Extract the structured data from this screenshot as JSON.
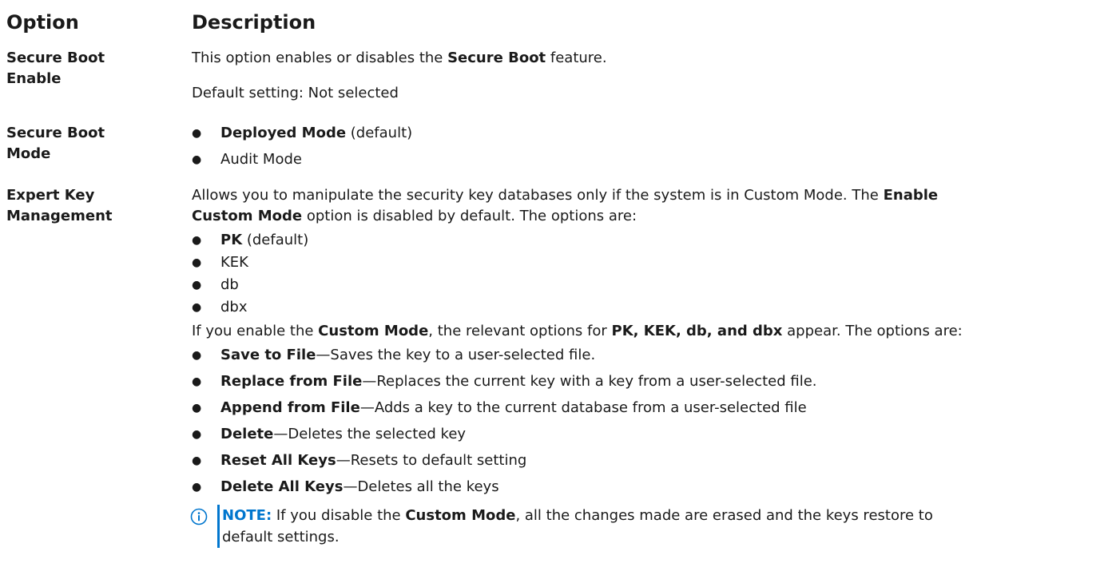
{
  "header": {
    "option": "Option",
    "description": "Description"
  },
  "rows": [
    {
      "option_line1": "Secure Boot",
      "option_line2": "Enable",
      "desc_pre": "This option enables or disables the ",
      "desc_bold": "Secure Boot",
      "desc_post": " feature.",
      "default": "Default setting: Not selected"
    },
    {
      "option_line1": "Secure Boot",
      "option_line2": "Mode",
      "items": [
        {
          "bold": "Deployed Mode",
          "rest": " (default)"
        },
        {
          "bold": "",
          "rest": "Audit Mode"
        }
      ]
    },
    {
      "option_line1": "Expert Key",
      "option_line2": "Management",
      "intro_pre": "Allows you to manipulate the security key databases only if the system is in Custom Mode. The ",
      "intro_bold1": "Enable",
      "intro_bold2": "Custom Mode",
      "intro_post": " option is disabled by default. The options are:",
      "keys": [
        {
          "bold": "PK",
          "rest": " (default)"
        },
        {
          "bold": "",
          "rest": "KEK"
        },
        {
          "bold": "",
          "rest": "db"
        },
        {
          "bold": "",
          "rest": "dbx"
        }
      ],
      "custom_pre": "If you enable the ",
      "custom_bold1": "Custom Mode",
      "custom_mid": ", the relevant options for ",
      "custom_bold2": "PK, KEK, db, and dbx",
      "custom_post": " appear. The options are:",
      "actions": [
        {
          "bold": "Save to File",
          "rest": "—Saves the key to a user-selected file."
        },
        {
          "bold": "Replace from File",
          "rest": "—Replaces the current key with a key from a user-selected file."
        },
        {
          "bold": "Append from File",
          "rest": "—Adds a key to the current database from a user-selected file"
        },
        {
          "bold": "Delete",
          "rest": "—Deletes the selected key"
        },
        {
          "bold": "Reset All Keys",
          "rest": "—Resets to default setting"
        },
        {
          "bold": "Delete All Keys",
          "rest": "—Deletes all the keys"
        }
      ],
      "note_label": "NOTE:",
      "note_pre": " If you disable the ",
      "note_bold": "Custom Mode",
      "note_post1": ", all the changes made are erased and the keys restore to",
      "note_post2": "default settings."
    }
  ],
  "colors": {
    "note_accent": "#0076ce",
    "text": "#1a1a1a"
  },
  "icons": {
    "bullet": "●",
    "note": "info-icon"
  }
}
